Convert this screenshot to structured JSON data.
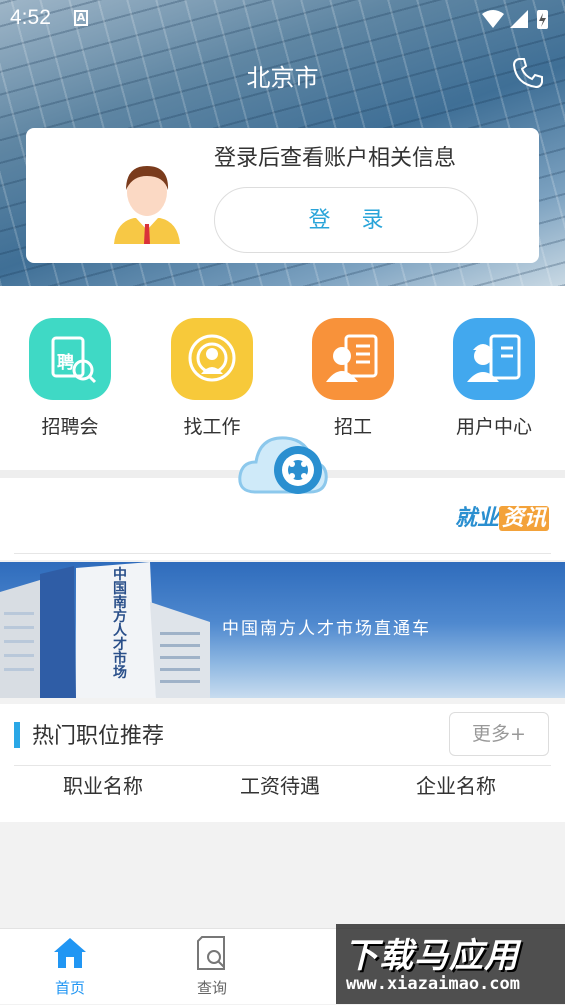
{
  "status_bar": {
    "time": "4:52",
    "a_badge": "A"
  },
  "header": {
    "city": "北京市"
  },
  "login_card": {
    "prompt": "登录后查看账户相关信息",
    "login_label": "登 录"
  },
  "menu": [
    {
      "label": "招聘会",
      "icon": "recruitment-fair-icon",
      "color": "#3fd9c5",
      "icon_text": "聘"
    },
    {
      "label": "找工作",
      "icon": "find-job-icon",
      "color": "#f7c93a"
    },
    {
      "label": "招工",
      "icon": "hire-icon",
      "color": "#f8923a"
    },
    {
      "label": "用户中心",
      "icon": "user-center-icon",
      "color": "#42a8ee"
    }
  ],
  "news": {
    "logo_part1": "就业",
    "logo_part2": "资讯"
  },
  "banner": {
    "text": "中国南方人才市场直通车",
    "building_sign": "中国南方人才市场"
  },
  "hot_jobs": {
    "title": "热门职位推荐",
    "more_label": "更多+",
    "columns": [
      "职业名称",
      "工资待遇",
      "企业名称"
    ]
  },
  "tabbar": [
    {
      "label": "首页",
      "icon": "home-icon",
      "active": true
    },
    {
      "label": "查询",
      "icon": "search-icon",
      "active": false
    }
  ],
  "watermark": {
    "title": "下载马应用",
    "url": "www.xiazaimao.com"
  },
  "colors": {
    "accent": "#2aa7e6",
    "active_tab": "#2196f3",
    "inactive_tab": "#666666"
  }
}
